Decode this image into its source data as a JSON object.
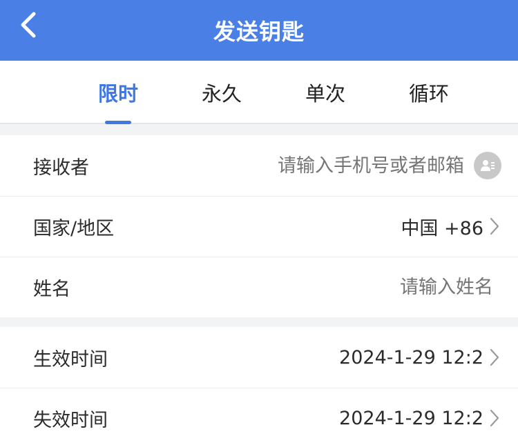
{
  "header": {
    "title": "发送钥匙"
  },
  "tabs": [
    {
      "label": "限时",
      "active": true
    },
    {
      "label": "永久",
      "active": false
    },
    {
      "label": "单次",
      "active": false
    },
    {
      "label": "循环",
      "active": false
    }
  ],
  "form": {
    "recipient": {
      "label": "接收者",
      "placeholder": "请输入手机号或者邮箱"
    },
    "country": {
      "label": "国家/地区",
      "value": "中国 +86"
    },
    "name": {
      "label": "姓名",
      "placeholder": "请输入姓名"
    }
  },
  "time": {
    "effective": {
      "label": "生效时间",
      "value": "2024-1-29 12:2"
    },
    "expire": {
      "label": "失效时间",
      "value": "2024-1-29 12:2"
    }
  },
  "colors": {
    "accent": "#4a7fe6",
    "tab_active": "#3f78e0"
  },
  "icons": {
    "back": "back-arrow-icon",
    "contact": "contact-book-icon",
    "chevron": "chevron-right-icon"
  }
}
